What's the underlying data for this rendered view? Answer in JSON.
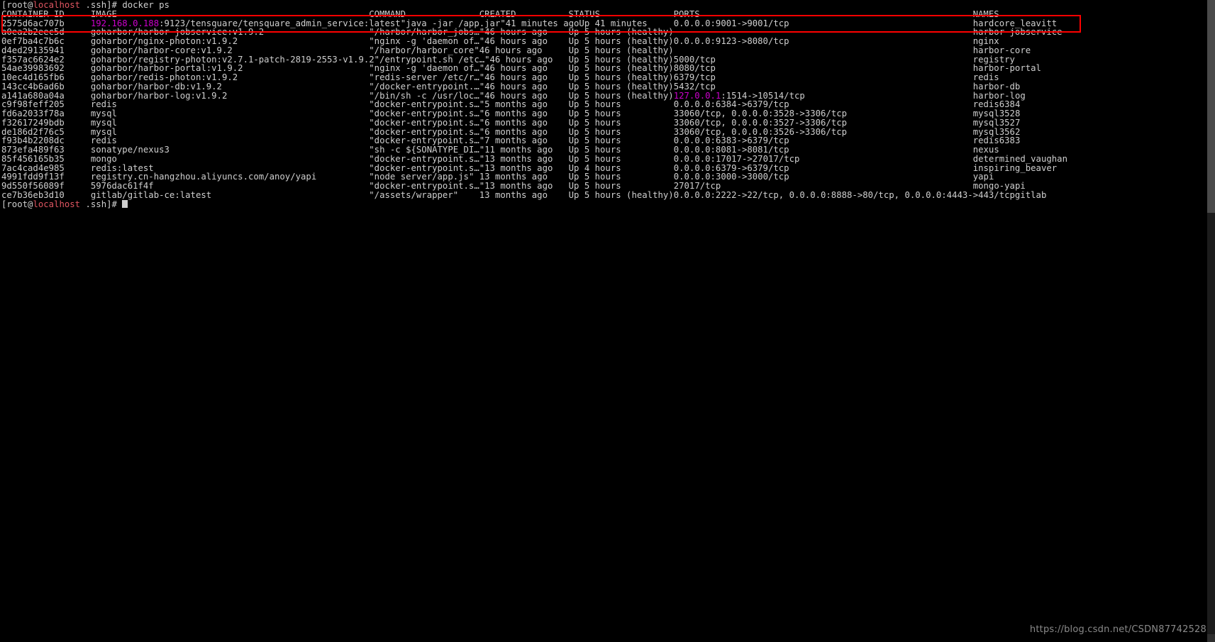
{
  "terminal": {
    "prompt_user": "root",
    "prompt_host": "localhost",
    "prompt_dir": ".ssh",
    "prompt_symbol": "]# ",
    "prompt_open": "[",
    "prompt_at": "@",
    "prompt_space": " ",
    "command": "docker ps",
    "final_prompt_command": ""
  },
  "table": {
    "headers": {
      "container_id": "CONTAINER ID",
      "image": "IMAGE",
      "command": "COMMAND",
      "created": "CREATED",
      "status": "STATUS",
      "ports": "PORTS",
      "names": "NAMES"
    },
    "rows": [
      {
        "container_id": "2575d6ac707b",
        "image_host": "192.168.0.188",
        "image_rest": ":9123/tensquare/tensquare_admin_service:latest",
        "image": "192.168.0.188:9123/tensquare/tensquare_admin_service:latest",
        "command": "\"java -jar /app.jar\"",
        "created": "41 minutes ago",
        "status": "Up 41 minutes",
        "ports": "0.0.0.0:9001->9001/tcp",
        "ports_host": "",
        "names": "hardcore_leavitt",
        "highlighted": true
      },
      {
        "container_id": "a0ea2b2eec5d",
        "image": "goharbor/harbor-jobservice:v1.9.2",
        "command": "\"/harbor/harbor_jobs…\"",
        "created": "46 hours ago",
        "status": "Up 5 hours (healthy)",
        "ports": "",
        "names": "harbor-jobservice",
        "highlighted": false
      },
      {
        "container_id": "0ef7ba4c7b6c",
        "image": "goharbor/nginx-photon:v1.9.2",
        "command": "\"nginx -g 'daemon of…\"",
        "created": "46 hours ago",
        "status": "Up 5 hours (healthy)",
        "ports": "0.0.0.0:9123->8080/tcp",
        "names": "nginx",
        "highlighted": false
      },
      {
        "container_id": "d4ed29135941",
        "image": "goharbor/harbor-core:v1.9.2",
        "command": "\"/harbor/harbor_core\"",
        "created": "46 hours ago",
        "status": "Up 5 hours (healthy)",
        "ports": "",
        "names": "harbor-core",
        "highlighted": false
      },
      {
        "container_id": "f357ac6624e2",
        "image": "goharbor/registry-photon:v2.7.1-patch-2819-2553-v1.9.2",
        "command": "\"/entrypoint.sh /etc…\"",
        "created": "46 hours ago",
        "status": "Up 5 hours (healthy)",
        "ports": "5000/tcp",
        "names": "registry",
        "highlighted": false
      },
      {
        "container_id": "54ae39983692",
        "image": "goharbor/harbor-portal:v1.9.2",
        "command": "\"nginx -g 'daemon of…\"",
        "created": "46 hours ago",
        "status": "Up 5 hours (healthy)",
        "ports": "8080/tcp",
        "names": "harbor-portal",
        "highlighted": false
      },
      {
        "container_id": "10ec4d165fb6",
        "image": "goharbor/redis-photon:v1.9.2",
        "command": "\"redis-server /etc/r…\"",
        "created": "46 hours ago",
        "status": "Up 5 hours (healthy)",
        "ports": "6379/tcp",
        "names": "redis",
        "highlighted": false
      },
      {
        "container_id": "143cc4b6ad6b",
        "image": "goharbor/harbor-db:v1.9.2",
        "command": "\"/docker-entrypoint.…\"",
        "created": "46 hours ago",
        "status": "Up 5 hours (healthy)",
        "ports": "5432/tcp",
        "names": "harbor-db",
        "highlighted": false
      },
      {
        "container_id": "a141a680a04a",
        "image": "goharbor/harbor-log:v1.9.2",
        "command": "\"/bin/sh -c /usr/loc…\"",
        "created": "46 hours ago",
        "status": "Up 5 hours (healthy)",
        "ports_host": "127.0.0.1",
        "ports_rest": ":1514->10514/tcp",
        "ports": "127.0.0.1:1514->10514/tcp",
        "names": "harbor-log",
        "highlighted": false
      },
      {
        "container_id": "c9f98feff205",
        "image": "redis",
        "command": "\"docker-entrypoint.s…\"",
        "created": "5 months ago",
        "status": "Up 5 hours",
        "ports": "0.0.0.0:6384->6379/tcp",
        "names": "redis6384",
        "highlighted": false
      },
      {
        "container_id": "fd6a2033f78a",
        "image": "mysql",
        "command": "\"docker-entrypoint.s…\"",
        "created": "6 months ago",
        "status": "Up 5 hours",
        "ports": "33060/tcp, 0.0.0.0:3528->3306/tcp",
        "names": "mysql3528",
        "highlighted": false
      },
      {
        "container_id": "f32617249bdb",
        "image": "mysql",
        "command": "\"docker-entrypoint.s…\"",
        "created": "6 months ago",
        "status": "Up 5 hours",
        "ports": "33060/tcp, 0.0.0.0:3527->3306/tcp",
        "names": "mysql3527",
        "highlighted": false
      },
      {
        "container_id": "de186d2f76c5",
        "image": "mysql",
        "command": "\"docker-entrypoint.s…\"",
        "created": "6 months ago",
        "status": "Up 5 hours",
        "ports": "33060/tcp, 0.0.0.0:3526->3306/tcp",
        "names": "mysql3562",
        "highlighted": false
      },
      {
        "container_id": "f93b4b2208dc",
        "image": "redis",
        "command": "\"docker-entrypoint.s…\"",
        "created": "7 months ago",
        "status": "Up 5 hours",
        "ports": "0.0.0.0:6383->6379/tcp",
        "names": "redis6383",
        "highlighted": false
      },
      {
        "container_id": "873efa489f63",
        "image": "sonatype/nexus3",
        "command": "\"sh -c ${SONATYPE_DI…\"",
        "created": "11 months ago",
        "status": "Up 5 hours",
        "ports": "0.0.0.0:8081->8081/tcp",
        "names": "nexus",
        "highlighted": false
      },
      {
        "container_id": "85f456165b35",
        "image": "mongo",
        "command": "\"docker-entrypoint.s…\"",
        "created": "13 months ago",
        "status": "Up 5 hours",
        "ports": "0.0.0.0:17017->27017/tcp",
        "names": "determined_vaughan",
        "highlighted": false
      },
      {
        "container_id": "7ac4cad4e985",
        "image": "redis:latest",
        "command": "\"docker-entrypoint.s…\"",
        "created": "13 months ago",
        "status": "Up 4 hours",
        "ports": "0.0.0.0:6379->6379/tcp",
        "names": "inspiring_beaver",
        "highlighted": false
      },
      {
        "container_id": "4991fdd9f13f",
        "image": "registry.cn-hangzhou.aliyuncs.com/anoy/yapi",
        "command": "\"node server/app.js\"",
        "created": "13 months ago",
        "status": "Up 5 hours",
        "ports": "0.0.0.0:3000->3000/tcp",
        "names": "yapi",
        "highlighted": false
      },
      {
        "container_id": "9d550f56089f",
        "image": "5976dac61f4f",
        "command": "\"docker-entrypoint.s…\"",
        "created": "13 months ago",
        "status": "Up 5 hours",
        "ports": "27017/tcp",
        "names": "mongo-yapi",
        "highlighted": false
      },
      {
        "container_id": "ce7b36eb3d10",
        "image": "gitlab/gitlab-ce:latest",
        "command": "\"/assets/wrapper\"",
        "created": "13 months ago",
        "status": "Up 5 hours (healthy)",
        "ports": "0.0.0.0:2222->22/tcp, 0.0.0.0:8888->80/tcp, 0.0.0.0:4443->443/tcp",
        "names": "gitlab",
        "highlighted": false
      }
    ]
  },
  "annotation": {
    "highlight_color": "#ff0000"
  },
  "watermark": {
    "text": "https://blog.csdn.net/CSDN87742528"
  },
  "colors": {
    "background": "#000000",
    "foreground": "#cfcfcf",
    "prompt_host": "#e05561",
    "image_host": "#cc00cc",
    "ports_localhost": "#cc00cc"
  }
}
